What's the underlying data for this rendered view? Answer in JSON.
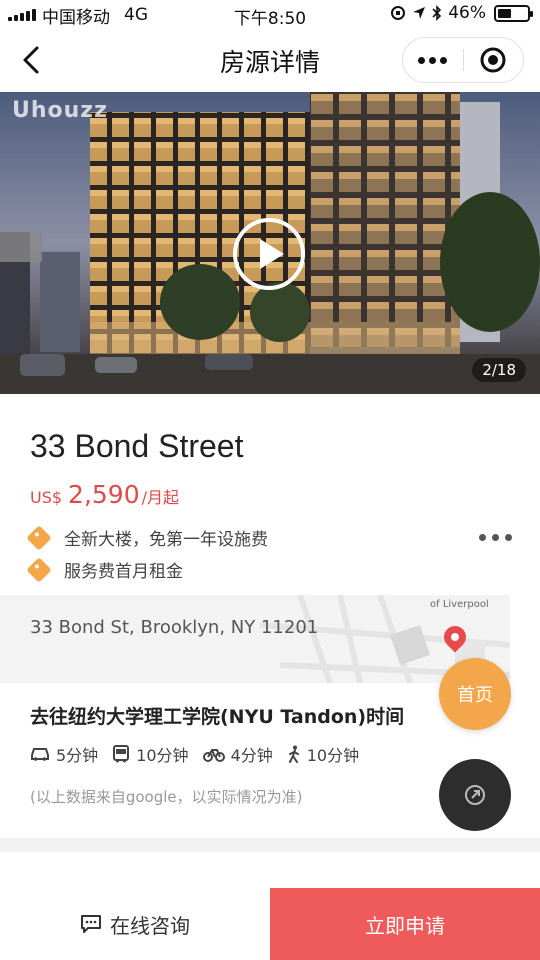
{
  "status_bar": {
    "carrier": "中国移动",
    "network": "4G",
    "time": "下午8:50",
    "battery": "46%",
    "battery_level": 0.46
  },
  "nav": {
    "title": "房源详情"
  },
  "hero": {
    "watermark": "Uhouzz",
    "counter": "2/18"
  },
  "listing": {
    "title": "33 Bond Street",
    "price_currency": "US$",
    "price_value": "2,590",
    "price_unit": "/月起",
    "tags": [
      "全新大楼，免第一年设施费",
      "服务费首月租金"
    ],
    "address": "33 Bond St, Brooklyn, NY 11201",
    "map_label": "of Liverpool"
  },
  "commute": {
    "title": "去往纽约大学理工学院(NYU Tandon)时间",
    "items": [
      {
        "icon": "car-icon",
        "text": "5分钟"
      },
      {
        "icon": "bus-icon",
        "text": "10分钟"
      },
      {
        "icon": "bike-icon",
        "text": "4分钟"
      },
      {
        "icon": "walk-icon",
        "text": "10分钟"
      }
    ],
    "note": "(以上数据来自google，以实际情况为准)"
  },
  "fab": {
    "home_label": "首页"
  },
  "bottom": {
    "consult_label": "在线咨询",
    "apply_label": "立即申请"
  },
  "colors": {
    "accent_orange": "#f3a64a",
    "price_red": "#e04a4a",
    "apply_red": "#ef5a5a"
  }
}
